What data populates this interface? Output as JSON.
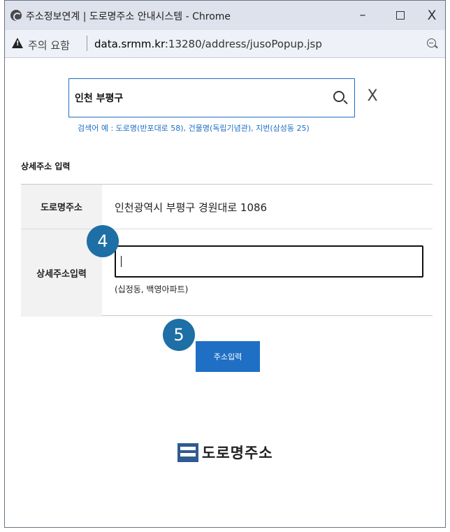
{
  "window": {
    "title": "주소정보연계 | 도로명주소 안내시스템 - Chrome",
    "controls": {
      "minimize": "–",
      "close": "X"
    }
  },
  "addressbar": {
    "security_label": "주의 요함",
    "url_host": "data.srmm.kr",
    "url_rest": ":13280/address/jusoPopup.jsp"
  },
  "search": {
    "value": "인천 부평구",
    "clear": "X",
    "hint": "검색어 예 : 도로명(반포대로 58), 건물명(독립기념관), 지번(삼성동 25)"
  },
  "detail_section": {
    "title": "상세주소 입력",
    "road_label": "도로명주소",
    "road_value": "인천광역시 부평구 경원대로 1086",
    "detail_label": "상세주소입력",
    "detail_value": "",
    "detail_hint": "(십정동, 백영아파트)"
  },
  "submit_label": "주소입력",
  "badges": {
    "step4": "4",
    "step5": "5"
  },
  "logo_text": "도로명주소",
  "colors": {
    "accent": "#1f6fc4",
    "badge": "#1d6fa5",
    "titlebar": "#dde2ec"
  }
}
